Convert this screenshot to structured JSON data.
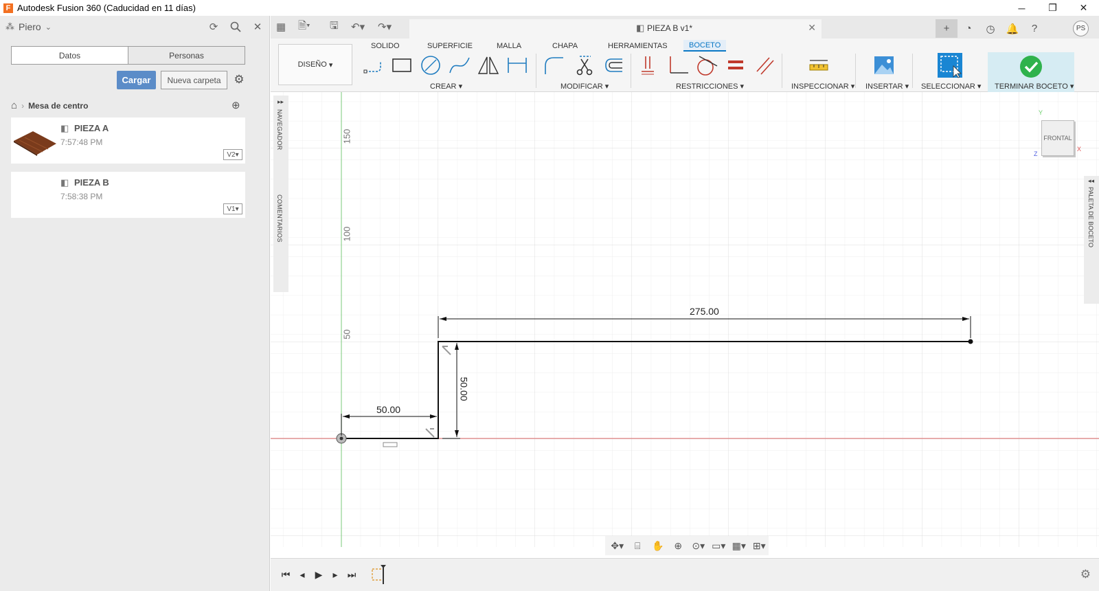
{
  "window": {
    "title": "Autodesk Fusion 360 (Caducidad en 11 días)",
    "app_icon_letter": "F",
    "minimize": "─",
    "restore": "❐",
    "close": "✕"
  },
  "data_panel": {
    "user": "Piero",
    "tabs": [
      "Datos",
      "Personas"
    ],
    "upload_button": "Cargar",
    "new_folder_button": "Nueva carpeta",
    "breadcrumb_folder": "Mesa de centro",
    "files": [
      {
        "name": "PIEZA A",
        "time": "7:57:48 PM",
        "version": "V2"
      },
      {
        "name": "PIEZA B",
        "time": "7:58:38 PM",
        "version": "V1"
      }
    ]
  },
  "document": {
    "tab_title": "PIEZA B v1*"
  },
  "ribbon": {
    "workspace": "DISEÑO",
    "tabs": [
      "SOLIDO",
      "SUPERFICIE",
      "MALLA",
      "CHAPA",
      "HERRAMIENTAS",
      "BOCETO"
    ],
    "active_tab": "BOCETO",
    "groups": [
      "CREAR",
      "MODIFICAR",
      "RESTRICCIONES",
      "INSPECCIONAR",
      "INSERTAR",
      "SELECCIONAR",
      "TERMINAR BOCETO"
    ]
  },
  "canvas": {
    "side_labels": [
      "NAVEGADOR",
      "COMENTARIOS"
    ],
    "right_palette": "PALETA DE BOCETO",
    "viewcube_face": "FRONTAL",
    "axis_labels": {
      "y": "Y",
      "x": "X",
      "z": "Z"
    },
    "ruler_labels": [
      "150",
      "100",
      "50"
    ],
    "dimensions": [
      "275.00",
      "50.00",
      "50.00"
    ]
  },
  "user_initials": "PS",
  "colors": {
    "accent": "#0b78c5",
    "upload_button": "#5b8cc8",
    "finish_check": "#2fb24c",
    "x_axis": "#e06a6a",
    "y_axis": "#8fd18f"
  }
}
